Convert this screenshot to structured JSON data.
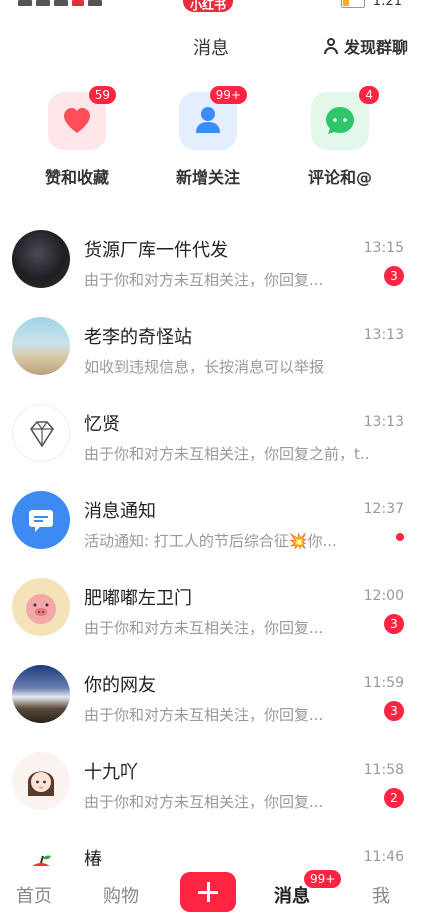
{
  "status_bar": {
    "app_pill": "小红书",
    "time": "1:21"
  },
  "header": {
    "title": "消息",
    "discover_label": "发现群聊",
    "discover_icon": "person-icon"
  },
  "categories": [
    {
      "label": "赞和收藏",
      "badge": "59",
      "icon": "heart-icon",
      "color": "#ff4d5a"
    },
    {
      "label": "新增关注",
      "badge": "99+",
      "icon": "person-icon",
      "color": "#3b8cff"
    },
    {
      "label": "评论和@",
      "badge": "4",
      "icon": "chat-bubble-icon",
      "color": "#2fc56b"
    }
  ],
  "messages": [
    {
      "name": "货源厂库一件代发",
      "time": "13:15",
      "preview": "由于你和对方未互相关注，你回复...",
      "unread": "3"
    },
    {
      "name": "老李的奇怪站",
      "time": "13:13",
      "preview": "如收到违规信息，长按消息可以举报",
      "unread": ""
    },
    {
      "name": "忆贤",
      "time": "13:13",
      "preview": "由于你和对方未互相关注，你回复之前，t...",
      "unread": ""
    },
    {
      "name": "消息通知",
      "time": "12:37",
      "preview": "活动通知: 打工人的节后综合征💥你...",
      "unread": "dot"
    },
    {
      "name": "肥嘟嘟左卫门",
      "time": "12:00",
      "preview": "由于你和对方未互相关注，你回复...",
      "unread": "3"
    },
    {
      "name": "你的网友",
      "time": "11:59",
      "preview": "由于你和对方未互相关注，你回复...",
      "unread": "3"
    },
    {
      "name": "十九吖",
      "time": "11:58",
      "preview": "由于你和对方未互相关注，你回复...",
      "unread": "2"
    },
    {
      "name": "椿",
      "time": "11:46",
      "preview": "",
      "unread": ""
    }
  ],
  "tabbar": {
    "home": "首页",
    "shop": "购物",
    "messages": "消息",
    "messages_badge": "99+",
    "me": "我"
  },
  "colors": {
    "accent": "#ff2442",
    "muted": "#999999"
  }
}
